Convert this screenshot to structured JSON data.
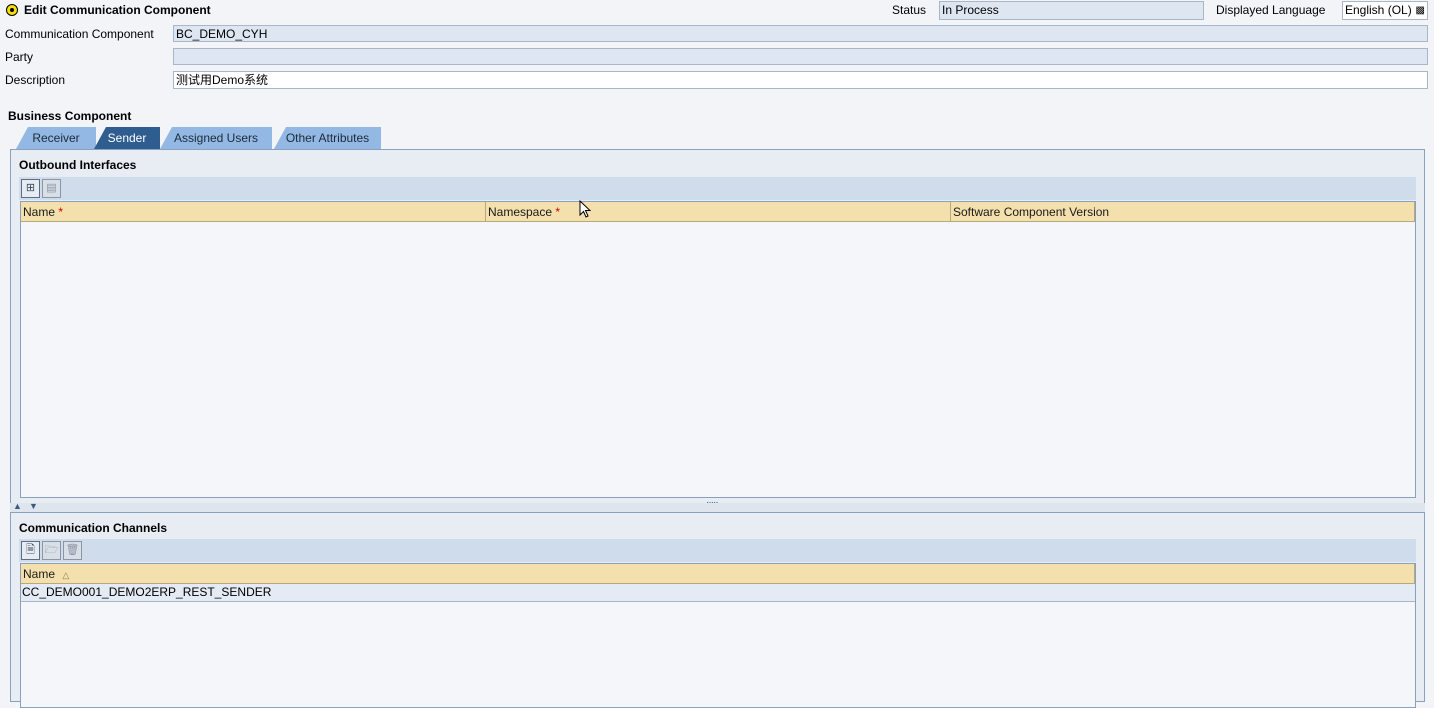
{
  "header": {
    "title": "Edit Communication Component",
    "status_label": "Status",
    "status_value": "In Process",
    "language_label": "Displayed Language",
    "language_value": "English (OL)"
  },
  "form": {
    "comm_component_label": "Communication Component",
    "comm_component_value": "BC_DEMO_CYH",
    "party_label": "Party",
    "party_value": "",
    "description_label": "Description",
    "description_value": "测试用Demo系统"
  },
  "business_component": {
    "title": "Business Component",
    "tabs": [
      {
        "label": "Receiver"
      },
      {
        "label": "Sender"
      },
      {
        "label": "Assigned Users"
      },
      {
        "label": "Other Attributes"
      }
    ],
    "active_tab": "Sender"
  },
  "outbound": {
    "title": "Outbound Interfaces",
    "columns": [
      {
        "label": "Name",
        "required": "*"
      },
      {
        "label": "Namespace",
        "required": "*"
      },
      {
        "label": "Software Component Version"
      }
    ]
  },
  "channels": {
    "title": "Communication Channels",
    "column_name": "Name",
    "sort_indicator": "△",
    "rows": [
      {
        "name": "CC_DEMO001_DEMO2ERP_REST_SENDER"
      }
    ]
  },
  "icons": {
    "add_row": "add-row-icon",
    "remove_row": "remove-row-icon",
    "new": "new-document-icon",
    "open": "open-folder-icon",
    "delete": "trash-icon",
    "dropdown": "dropdown-icon"
  },
  "colors": {
    "active_tab": "#2f5d8f",
    "tab": "#92b8e3",
    "header_row": "#f4e0ad",
    "field": "#dde6f1"
  }
}
